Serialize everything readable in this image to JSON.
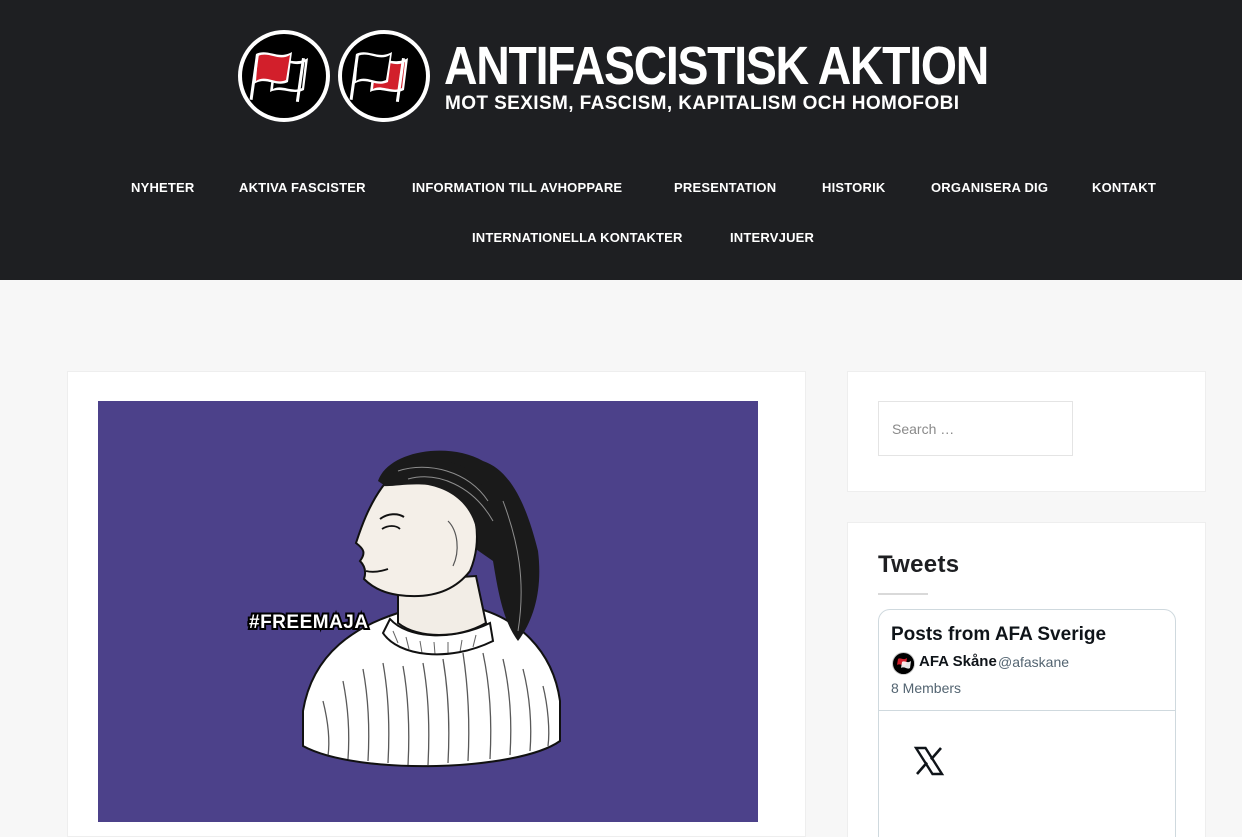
{
  "header": {
    "site_title": "ANTIFASCISTISK AKTION",
    "tagline": "MOT SEXISM, FASCISM, KAPITALISM OCH HOMOFOBI",
    "colors": {
      "background": "#1e1f22",
      "flag_red": "#d21f2b",
      "flag_black": "#000000"
    }
  },
  "nav": {
    "row1": [
      "NYHETER",
      "AKTIVA FASCISTER",
      "INFORMATION TILL AVHOPPARE",
      "PRESENTATION",
      "HISTORIK",
      "ORGANISERA DIG",
      "KONTAKT"
    ],
    "row2": [
      "INTERNATIONELLA KONTAKTER",
      "INTERVJUER"
    ]
  },
  "post": {
    "image_icon": "freemaja-portrait-illustration",
    "image_text": "#FREEMAJA",
    "image_background": "#4c418a"
  },
  "sidebar": {
    "search": {
      "placeholder": "Search …"
    },
    "tweets": {
      "title": "Tweets",
      "embed_heading": "Posts from AFA Sverige",
      "account_name": "AFA Skåne",
      "account_handle": "@afaskane",
      "members": "8 Members",
      "logo_icon": "x-logo-icon"
    }
  }
}
